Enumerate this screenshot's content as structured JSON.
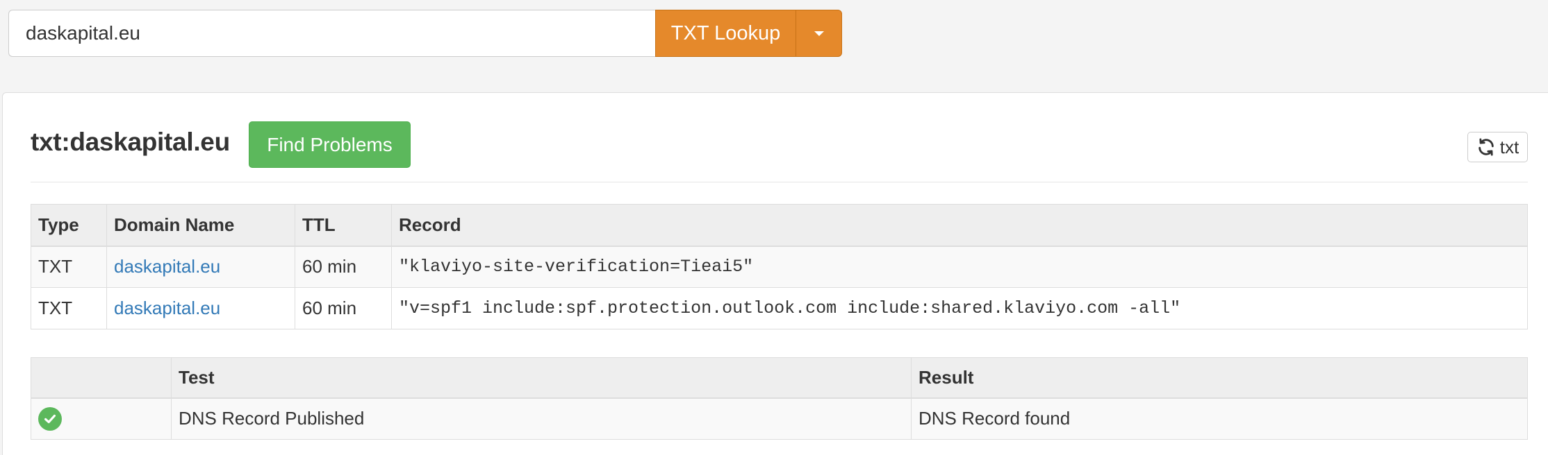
{
  "search": {
    "value": "daskapital.eu",
    "lookup_label": "TXT Lookup"
  },
  "panel": {
    "title": "txt:daskapital.eu",
    "find_problems_label": "Find Problems",
    "refresh_label": "txt"
  },
  "records": {
    "headers": [
      "Type",
      "Domain Name",
      "TTL",
      "Record"
    ],
    "rows": [
      {
        "type": "TXT",
        "domain": "daskapital.eu",
        "ttl": "60 min",
        "record": "\"klaviyo-site-verification=Tieai5\""
      },
      {
        "type": "TXT",
        "domain": "daskapital.eu",
        "ttl": "60 min",
        "record": "\"v=spf1 include:spf.protection.outlook.com include:shared.klaviyo.com -all\""
      }
    ]
  },
  "tests": {
    "headers": [
      "",
      "Test",
      "Result"
    ],
    "rows": [
      {
        "status_icon": "check-circle-icon",
        "test": "DNS Record Published",
        "result": "DNS Record found"
      }
    ]
  },
  "colors": {
    "lookup_button": "#e5892b",
    "find_problems_button": "#5cb85c",
    "link": "#337ab7",
    "success": "#5cb85c"
  }
}
